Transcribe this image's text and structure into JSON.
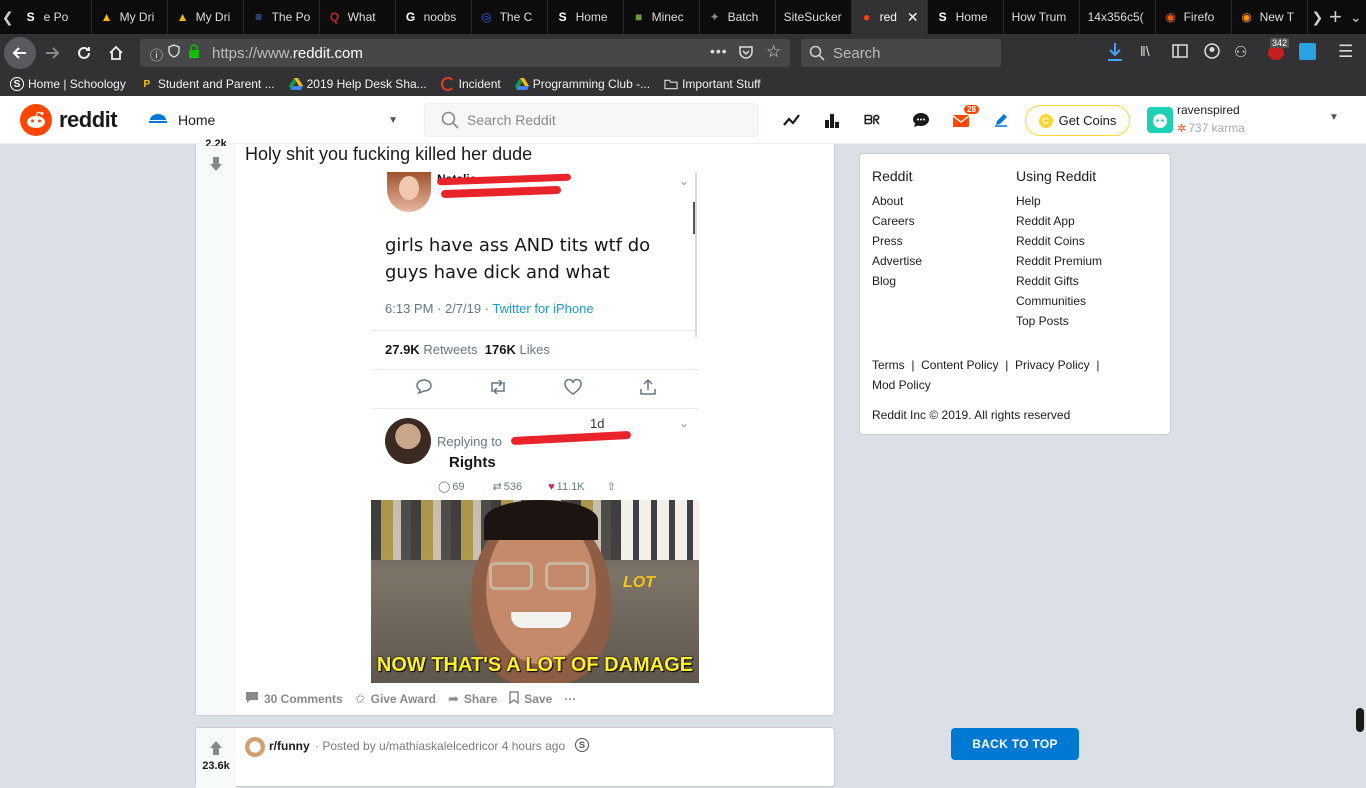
{
  "tabs": [
    {
      "title": "e Po",
      "icon": "s-logo-icon",
      "color": "#ffffff"
    },
    {
      "title": "My Dri",
      "icon": "google-drive-icon",
      "color": "#fbbc04"
    },
    {
      "title": "My Dri",
      "icon": "google-drive-icon",
      "color": "#fbbc04"
    },
    {
      "title": "The Po",
      "icon": "google-docs-icon",
      "color": "#4285f4"
    },
    {
      "title": "What",
      "icon": "quora-icon",
      "color": "#b92b27"
    },
    {
      "title": "noobs",
      "icon": "google-icon",
      "color": "#ffffff"
    },
    {
      "title": "The C",
      "icon": "globe-icon",
      "color": "#3b5bdb"
    },
    {
      "title": "Home",
      "icon": "s-logo-icon",
      "color": "#ffffff"
    },
    {
      "title": "Minec",
      "icon": "minecraft-icon",
      "color": "#6a9a3a"
    },
    {
      "title": "Batch",
      "icon": "batch-icon",
      "color": "#888888"
    },
    {
      "title": "SiteSucker",
      "icon": "",
      "color": ""
    },
    {
      "title": "red",
      "icon": "reddit-icon",
      "color": "#ff4500",
      "active": true
    },
    {
      "title": "Home",
      "icon": "s-logo-icon",
      "color": "#ffffff"
    },
    {
      "title": "How Trum",
      "icon": "",
      "color": ""
    },
    {
      "title": "14x356c5(",
      "icon": "",
      "color": ""
    },
    {
      "title": "Firefo",
      "icon": "firefox-icon",
      "color": "#e66000"
    },
    {
      "title": "New T",
      "icon": "firefox-icon",
      "color": "#ff9400"
    }
  ],
  "nav": {
    "url_prefix": "https://www.",
    "url_domain": "reddit.com",
    "search_placeholder": "Search",
    "badge_count": "342"
  },
  "bookmarks": [
    {
      "label": "Home | Schoology",
      "icon": "s-logo-icon"
    },
    {
      "label": "Student and Parent ...",
      "icon": "p-logo-icon"
    },
    {
      "label": "2019 Help Desk Sha...",
      "icon": "google-drive-icon"
    },
    {
      "label": "Incident",
      "icon": "incident-icon"
    },
    {
      "label": "Programming Club -...",
      "icon": "google-drive-icon"
    },
    {
      "label": "Important Stuff",
      "icon": "folder-icon"
    }
  ],
  "reddit": {
    "logo_text": "reddit",
    "feed_label": "Home",
    "search_placeholder": "Search Reddit",
    "mail_count": "28",
    "get_coins": "Get Coins",
    "username": "ravenspired",
    "karma": "737 karma"
  },
  "post": {
    "vote_count": "2.2k",
    "title": "Holy shit you fucking killed her dude",
    "comments": "30 Comments",
    "give_award": "Give Award",
    "share": "Share",
    "save": "Save",
    "more": "···"
  },
  "tweet": {
    "author_name": "Natalie",
    "text": "girls have ass AND tits wtf do guys have dick and what",
    "time": "6:13 PM · 2/7/19 · ",
    "client": "Twitter for iPhone",
    "retweets_num": "27.9K",
    "retweets_label": "Retweets",
    "likes_num": "176K",
    "likes_label": "Likes",
    "reply_time": "1d",
    "replying_to": "Replying to",
    "reply_text": "Rights",
    "reply_comments": "69",
    "reply_retweets": "536",
    "reply_likes": "11.1K",
    "meme_caption": "NOW THAT'S A LOT OF DAMAGE",
    "meme_sign": "LOT"
  },
  "post2": {
    "vote_count": "23.6k",
    "subreddit": "r/funny",
    "posted_by": "· Posted by u/mathiaskalelcedricor 4 hours ago"
  },
  "sidebar": {
    "col1_title": "Reddit",
    "col1_links": [
      "About",
      "Careers",
      "Press",
      "Advertise",
      "Blog"
    ],
    "col2_title": "Using Reddit",
    "col2_links": [
      "Help",
      "Reddit App",
      "Reddit Coins",
      "Reddit Premium",
      "Reddit Gifts",
      "Communities",
      "Top Posts"
    ],
    "terms": "Terms",
    "content_policy": "Content Policy",
    "privacy_policy": "Privacy Policy",
    "mod_policy": "Mod Policy",
    "copyright": "Reddit Inc © 2019. All rights reserved",
    "sep": "|"
  },
  "back_to_top": "BACK TO TOP"
}
